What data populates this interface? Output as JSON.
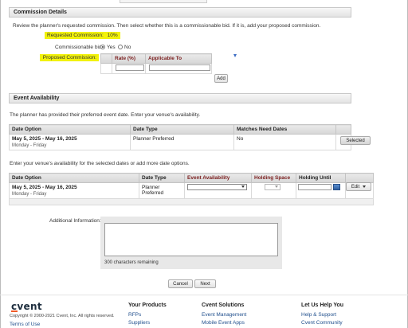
{
  "commission": {
    "header": "Commission Details",
    "intro": "Review the planner's requested commission. Then select whether this is a commissionable bid. If it is, add your proposed commission.",
    "requested_label": "Requested Commission:",
    "requested_value": "10%",
    "commissionable_label": "Commissionable bid:",
    "yes_label": "Yes",
    "no_label": "No",
    "proposed_label": "Proposed Commission:",
    "col_rate": "Rate (%)",
    "col_applicable": "Applicable To",
    "filter_icon": "funnel-icon",
    "add_label": "Add"
  },
  "availability": {
    "header": "Event Availability",
    "intro": "The planner has provided their preferred event date. Enter your venue's availability.",
    "preferred_table": {
      "columns": [
        "Date Option",
        "Date Type",
        "Matches Need Dates",
        ""
      ],
      "row": {
        "date": "May 5, 2025 - May 16, 2025",
        "days": "Monday - Friday",
        "type": "Planner Preferred",
        "matches": "No",
        "button": "Selected"
      }
    },
    "venue_intro": "Enter your venue's availability for the selected dates or add more date options.",
    "venue_table": {
      "columns": [
        "Date Option",
        "Date Type",
        "Event Availability",
        "Holding Space",
        "Holding Until",
        ""
      ],
      "row": {
        "date": "May 5, 2025 - May 16, 2025",
        "days": "Monday - Friday",
        "type": "Planner Preferred",
        "edit": "Edit"
      }
    }
  },
  "additional": {
    "label": "Additional Information:",
    "remaining": "300 characters remaining"
  },
  "actions": {
    "cancel": "Cancel",
    "next": "Next"
  },
  "footer": {
    "logo": "cvent",
    "copyright": "Copyright © 2000-2021 Cvent, Inc. All rights reserved.",
    "terms": "Terms of Use",
    "columns": [
      {
        "title": "Your Products",
        "links": [
          "RFPs",
          "Suppliers"
        ]
      },
      {
        "title": "Cvent Solutions",
        "links": [
          "Event Management",
          "Mobile Event Apps"
        ]
      },
      {
        "title": "Let Us Help You",
        "links": [
          "Help & Support",
          "Cvent Community"
        ]
      }
    ]
  },
  "colors": {
    "highlight": "#f2f20a",
    "maroon": "#7a1e1e",
    "link": "#1f4e8c",
    "logo_accent": "#f05a28"
  }
}
